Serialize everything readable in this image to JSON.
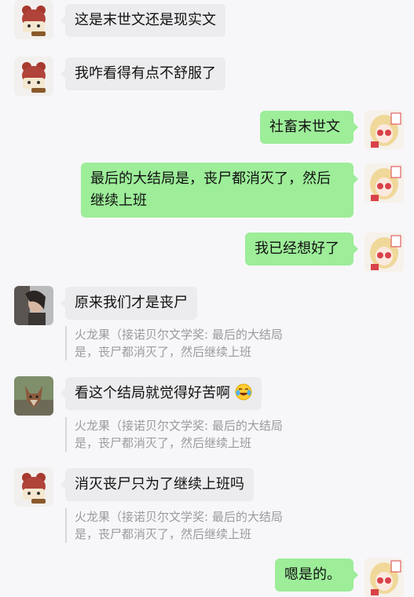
{
  "messages": [
    {
      "side": "left",
      "avatar": "bear-hat-avatar",
      "text": "这是末世文还是现实文"
    },
    {
      "side": "left",
      "avatar": "bear-hat-avatar",
      "text": "我咋看得有点不舒服了"
    },
    {
      "side": "right",
      "avatar": "anime-girl-avatar",
      "text": "社畜末世文"
    },
    {
      "side": "right",
      "avatar": "anime-girl-avatar",
      "line1": "最后的大结局是，丧尸都消灭了，然后",
      "line2": "继续上班"
    },
    {
      "side": "right",
      "avatar": "anime-girl-avatar",
      "text": "我已经想好了"
    },
    {
      "side": "left",
      "avatar": "woman-photo-avatar",
      "text": "原来我们才是丧尸"
    },
    {
      "side": "left",
      "avatar": "fox-photo-avatar",
      "text": "看这个结局就觉得好苦啊",
      "emoji": "laugh-cry-emoji"
    },
    {
      "side": "left",
      "avatar": "bear-hat-avatar",
      "text": "消灭丧尸只为了继续上班吗"
    },
    {
      "side": "right",
      "avatar": "anime-girl-avatar",
      "text": "嗯是的。"
    }
  ],
  "quotes": [
    {
      "line1": "火龙果（接诺贝尔文学奖: 最后的大结局",
      "line2": "是，丧尸都消灭了，然后继续上班"
    },
    {
      "line1": "火龙果（接诺贝尔文学奖: 最后的大结局",
      "line2": "是，丧尸都消灭了，然后继续上班"
    },
    {
      "line1": "火龙果（接诺贝尔文学奖: 最后的大结局",
      "line2": "是，丧尸都消灭了，然后继续上班"
    }
  ],
  "colors": {
    "background": "#f7f7f9",
    "incoming_bubble": "#ececee",
    "outgoing_bubble": "#9ded99",
    "quote_text": "#9b9b9f"
  }
}
